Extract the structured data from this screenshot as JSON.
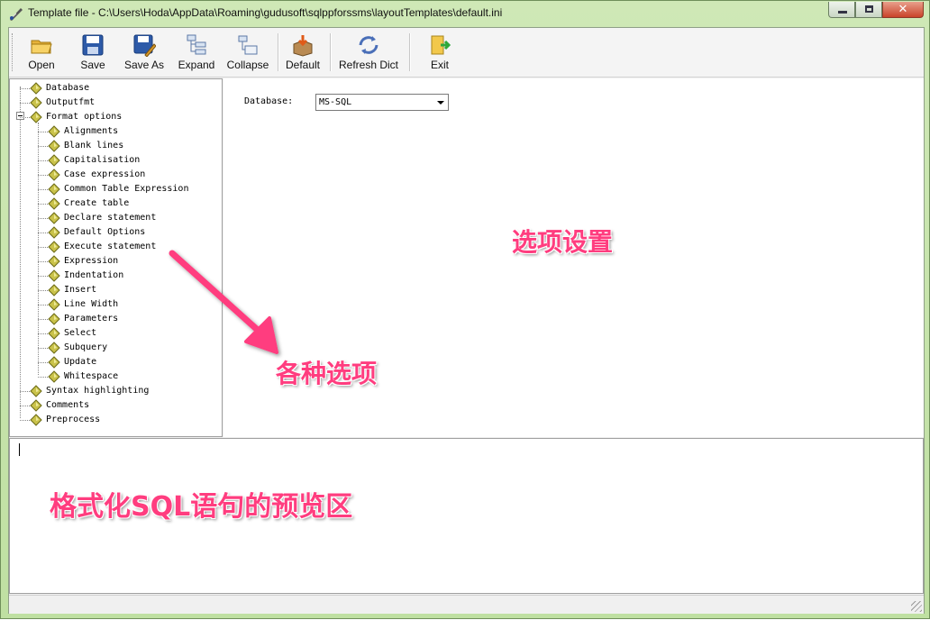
{
  "window": {
    "title": "Template file  - C:\\Users\\Hoda\\AppData\\Roaming\\gudusoft\\sqlppforssms\\layoutTemplates\\default.ini",
    "close_glyph": "✕"
  },
  "toolbar": {
    "open_label": "Open",
    "save_label": "Save",
    "save_as_label": "Save As",
    "expand_label": "Expand",
    "collapse_label": "Collapse",
    "default_label": "Default",
    "refresh_label": "Refresh Dict",
    "exit_label": "Exit"
  },
  "tree": {
    "items": [
      "Database",
      "Outputfmt",
      "Format options",
      "Alignments",
      "Blank lines",
      "Capitalisation",
      "Case expression",
      "Common Table Expression",
      "Create table",
      "Declare statement",
      "Default Options",
      "Execute statement",
      "Expression",
      "Indentation",
      "Insert",
      "Line Width",
      "Parameters",
      "Select",
      "Subquery",
      "Update",
      "Whitespace",
      "Syntax highlighting",
      "Comments",
      "Preprocess"
    ]
  },
  "options": {
    "database_label": "Database:",
    "database_value": "MS-SQL"
  },
  "annotations": {
    "options_settings": "选项设置",
    "various_options": "各种选项",
    "preview_area": "格式化SQL语句的预览区",
    "color": "#ff3d7f"
  }
}
